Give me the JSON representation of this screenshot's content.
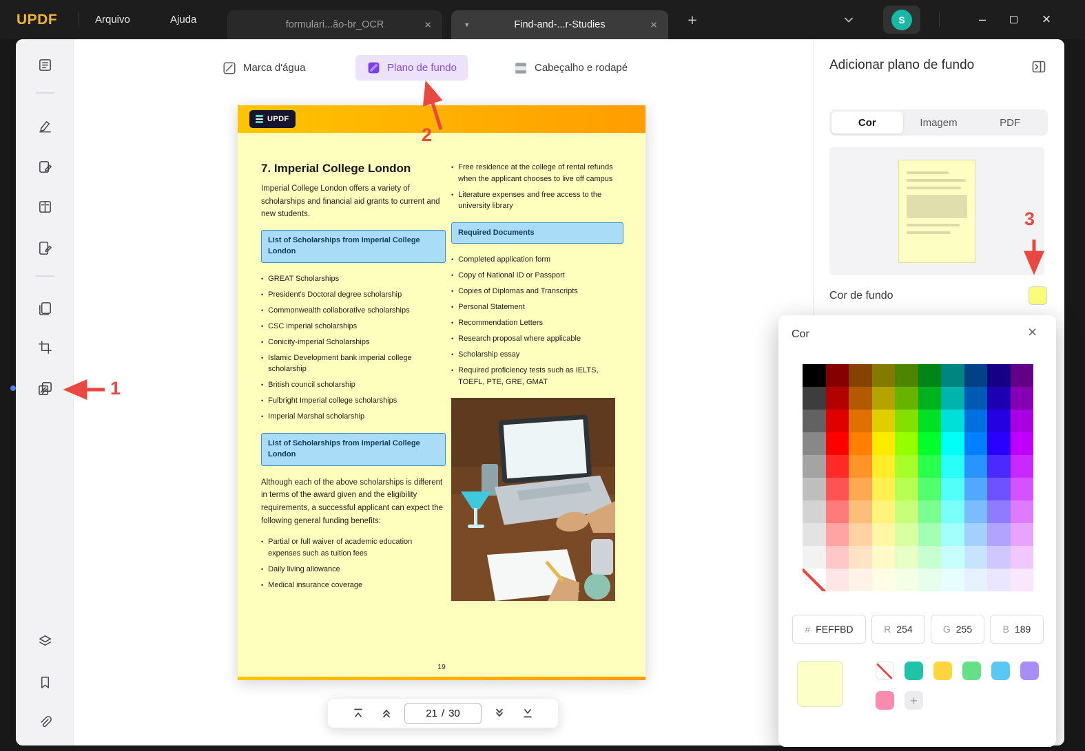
{
  "colors": {
    "accent_purple": "#8a4be0",
    "chip_bg": "#ece3fb",
    "arrow_red": "#e8483f",
    "page_bg": "#feffbd",
    "header_grad_1": "#ffc400",
    "header_grad_2": "#ff9d00",
    "bluebox_bg": "#a8dcf7",
    "bluebox_border": "#3e8fc9",
    "avatar_teal": "#17b8a6",
    "swatch_yellow": "#fbfd79",
    "picker_current": "#fdffc9"
  },
  "icons": {
    "close": "×",
    "plus": "+",
    "caret_down": "▾",
    "minimize": "–",
    "bullet": "•",
    "add_preset": "+"
  },
  "titlebar": {
    "logo": "UPDF",
    "menu_items": [
      "Arquivo",
      "Ajuda"
    ],
    "tabs": [
      {
        "label": "formulari...ão-br_OCR"
      },
      {
        "label": "Find-and-...r-Studies"
      }
    ],
    "avatar_initial": "S"
  },
  "format_toolbar": {
    "watermark_label": "Marca d'água",
    "background_label": "Plano de fundo",
    "header_footer_label": "Cabeçalho e rodapé"
  },
  "document": {
    "brand": "UPDF",
    "title": "7. Imperial College London",
    "intro": "Imperial College London offers a variety of scholarships and financial aid grants to current and new students.",
    "scholarship_box_title": "List of Scholarships from Imperial College London",
    "scholarships": [
      "GREAT Scholarships",
      "President's Doctoral degree scholarship",
      "Commonwealth collaborative scholarships",
      "CSC imperial scholarships",
      "Conicity-imperial Scholarships",
      "Islamic Development bank imperial college scholarship",
      "British council scholarship",
      "Fulbright Imperial college scholarships",
      "Imperial Marshal scholarship"
    ],
    "scholarship_box2_title": "List of Scholarships from Imperial College London",
    "closing_paragraph": "Although each of the above scholarships is different in terms of the award given and the eligibility requirements, a successful applicant can expect the following general funding benefits:",
    "benefits": [
      "Partial or full waiver of academic education expenses such as tuition fees",
      "Daily living allowance",
      "Medical insurance coverage"
    ],
    "campus_bullets": [
      "Free residence at the college of rental refunds when the applicant chooses to live off campus",
      "Literature expenses and free access to the university library"
    ],
    "required_docs_title": "Required Documents",
    "required_documents": [
      "Completed application form",
      "Copy of National ID or Passport",
      "Copies of Diplomas and Transcripts",
      "Personal Statement",
      "Recommendation Letters",
      "Research proposal where applicable",
      "Scholarship essay",
      "Required proficiency tests such as IELTS, TOEFL, PTE, GRE, GMAT"
    ],
    "page_number": "19"
  },
  "pagination": {
    "current": "21",
    "separator": "/",
    "total": "30"
  },
  "right_panel": {
    "title": "Adicionar plano de fundo",
    "tabs": [
      "Cor",
      "Imagem",
      "PDF"
    ],
    "active_tab": "Cor",
    "bg_color_label": "Cor de fundo"
  },
  "color_picker": {
    "title": "Cor",
    "hex_prefix": "#",
    "hex_value": "FEFFBD",
    "rgb_fields": [
      {
        "label": "R",
        "value": "254"
      },
      {
        "label": "G",
        "value": "255"
      },
      {
        "label": "B",
        "value": "189"
      }
    ],
    "palette": {
      "grays": [
        "#000000",
        "#3d3d3d",
        "#626262",
        "#888888",
        "#a4a4a4",
        "#bebebe",
        "#d3d3d3",
        "#e3e3e3",
        "#f2f2f2"
      ],
      "hues": [
        0,
        30,
        55,
        85,
        130,
        178,
        210,
        250,
        285
      ],
      "lightness": [
        26,
        35,
        44,
        50,
        58,
        66,
        74,
        82,
        89,
        95
      ]
    },
    "presets": [
      {
        "type": "none"
      },
      {
        "type": "color",
        "value": "#1fc3a8"
      },
      {
        "type": "color",
        "value": "#ffd53e"
      },
      {
        "type": "color",
        "value": "#66e086"
      },
      {
        "type": "color",
        "value": "#59c9f4"
      },
      {
        "type": "color",
        "value": "#a78df5"
      },
      {
        "type": "color",
        "value": "#fa8bae"
      },
      {
        "type": "add"
      }
    ]
  },
  "annotations": {
    "step1": "1",
    "step2": "2",
    "step3": "3"
  }
}
